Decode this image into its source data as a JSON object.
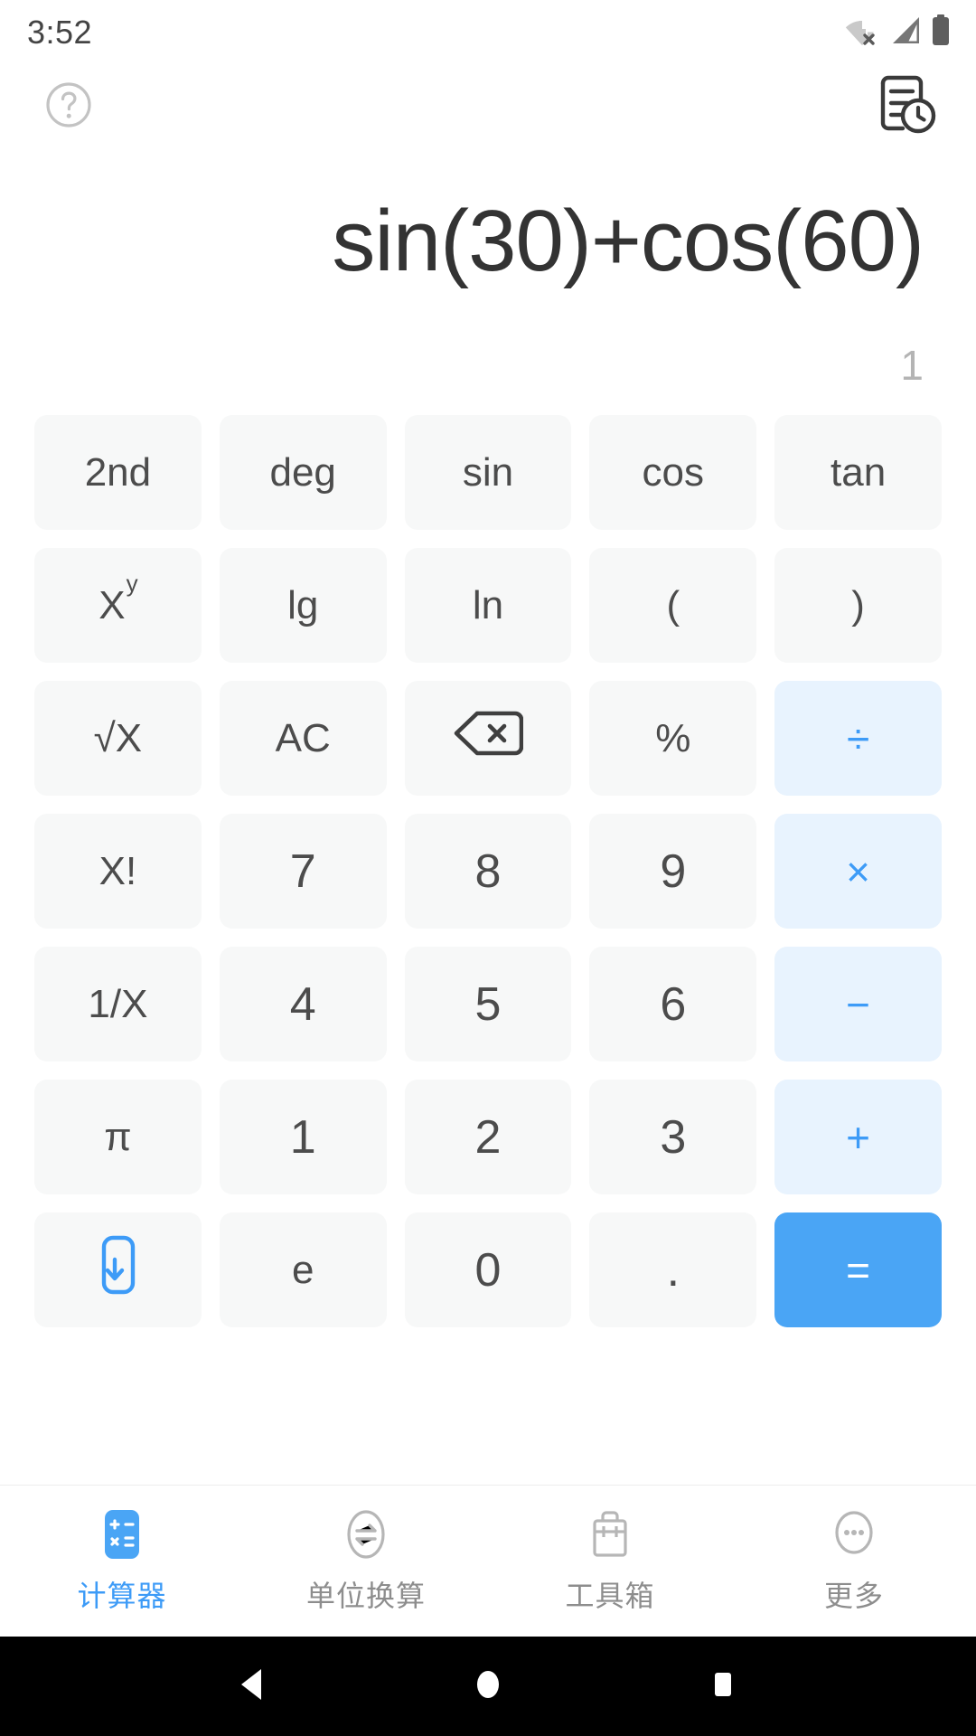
{
  "status_bar": {
    "time": "3:52",
    "icons": [
      "wifi-off-icon",
      "signal-icon",
      "battery-icon"
    ]
  },
  "top_bar": {
    "help_icon": "help-circle-icon",
    "history_icon": "history-document-icon"
  },
  "display": {
    "expression": "sin(30)+cos(60)",
    "result": "1"
  },
  "colors": {
    "accent": "#4aa5f5",
    "operator_bg": "#e8f3fe",
    "operator_fg": "#3d9bf7",
    "key_bg": "#f7f8f8",
    "key_fg": "#4c4c4c",
    "expression_fg": "#333333",
    "result_fg": "#b4b4b4"
  },
  "keypad": {
    "rows": [
      [
        {
          "label": "2nd",
          "name": "key-2nd",
          "type": "fn"
        },
        {
          "label": "deg",
          "name": "key-deg",
          "type": "fn"
        },
        {
          "label": "sin",
          "name": "key-sin",
          "type": "fn"
        },
        {
          "label": "cos",
          "name": "key-cos",
          "type": "fn"
        },
        {
          "label": "tan",
          "name": "key-tan",
          "type": "fn"
        }
      ],
      [
        {
          "label": "X",
          "sup": "y",
          "name": "key-power",
          "type": "fn"
        },
        {
          "label": "lg",
          "name": "key-lg",
          "type": "fn"
        },
        {
          "label": "ln",
          "name": "key-ln",
          "type": "fn"
        },
        {
          "label": "(",
          "name": "key-open-paren",
          "type": "fn"
        },
        {
          "label": ")",
          "name": "key-close-paren",
          "type": "fn"
        }
      ],
      [
        {
          "label": "√X",
          "name": "key-sqrt",
          "type": "fn"
        },
        {
          "label": "AC",
          "name": "key-all-clear",
          "type": "fn"
        },
        {
          "label": "",
          "name": "key-backspace",
          "type": "icon",
          "icon": "backspace-icon"
        },
        {
          "label": "%",
          "name": "key-percent",
          "type": "fn"
        },
        {
          "label": "÷",
          "name": "key-divide",
          "type": "op"
        }
      ],
      [
        {
          "label": "X!",
          "name": "key-factorial",
          "type": "fn"
        },
        {
          "label": "7",
          "name": "key-7",
          "type": "num"
        },
        {
          "label": "8",
          "name": "key-8",
          "type": "num"
        },
        {
          "label": "9",
          "name": "key-9",
          "type": "num"
        },
        {
          "label": "×",
          "name": "key-multiply",
          "type": "op"
        }
      ],
      [
        {
          "label": "1/X",
          "name": "key-reciprocal",
          "type": "fn"
        },
        {
          "label": "4",
          "name": "key-4",
          "type": "num"
        },
        {
          "label": "5",
          "name": "key-5",
          "type": "num"
        },
        {
          "label": "6",
          "name": "key-6",
          "type": "num"
        },
        {
          "label": "−",
          "name": "key-minus",
          "type": "op"
        }
      ],
      [
        {
          "label": "π",
          "name": "key-pi",
          "type": "fn"
        },
        {
          "label": "1",
          "name": "key-1",
          "type": "num"
        },
        {
          "label": "2",
          "name": "key-2",
          "type": "num"
        },
        {
          "label": "3",
          "name": "key-3",
          "type": "num"
        },
        {
          "label": "+",
          "name": "key-plus",
          "type": "op"
        }
      ],
      [
        {
          "label": "",
          "name": "key-collapse-keypad",
          "type": "icon",
          "icon": "keypad-collapse-icon"
        },
        {
          "label": "e",
          "name": "key-e",
          "type": "fn"
        },
        {
          "label": "0",
          "name": "key-0",
          "type": "num"
        },
        {
          "label": ".",
          "name": "key-decimal",
          "type": "dot"
        },
        {
          "label": "=",
          "name": "key-equals",
          "type": "eq"
        }
      ]
    ]
  },
  "tab_bar": {
    "tabs": [
      {
        "label": "计算器",
        "name": "tab-calculator",
        "icon": "calculator-icon",
        "active": true
      },
      {
        "label": "单位换算",
        "name": "tab-unit-conversion",
        "icon": "convert-icon",
        "active": false
      },
      {
        "label": "工具箱",
        "name": "tab-toolbox",
        "icon": "toolbox-icon",
        "active": false
      },
      {
        "label": "更多",
        "name": "tab-more",
        "icon": "more-icon",
        "active": false
      }
    ]
  },
  "android_nav": {
    "buttons": [
      {
        "name": "nav-back-button",
        "icon": "back-triangle-icon"
      },
      {
        "name": "nav-home-button",
        "icon": "home-circle-icon"
      },
      {
        "name": "nav-recents-button",
        "icon": "recents-square-icon"
      }
    ]
  }
}
